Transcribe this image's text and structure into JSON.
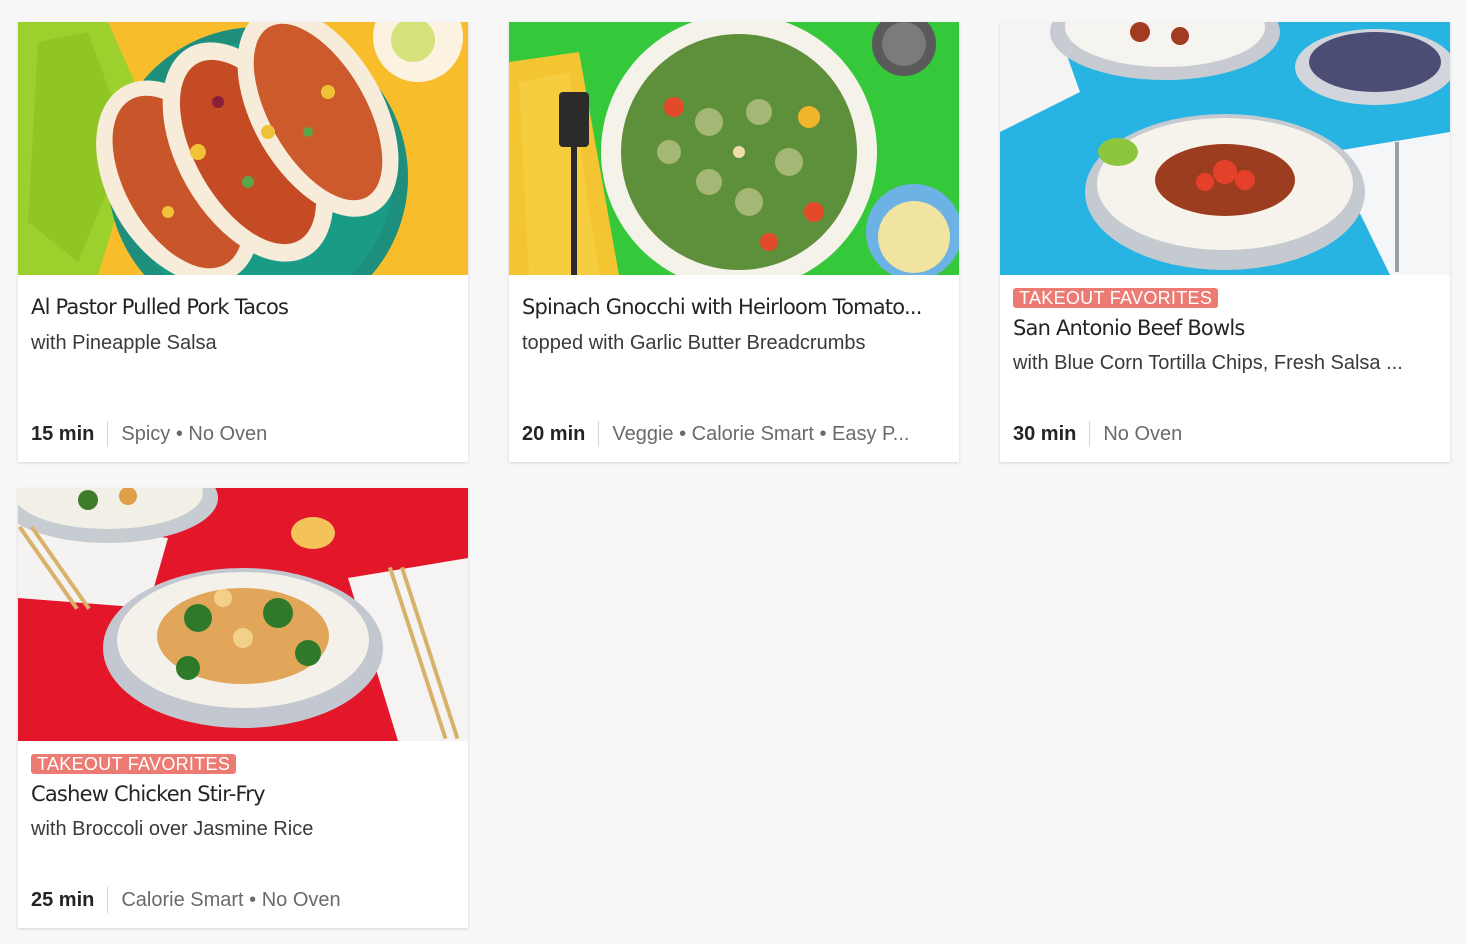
{
  "recipes": [
    {
      "badge": "",
      "title": "Al Pastor Pulled Pork Tacos",
      "subtitle": "with Pineapple Salsa",
      "time": "15 min",
      "tags": "Spicy • No Oven"
    },
    {
      "badge": "",
      "title": "Spinach Gnocchi with Heirloom Tomato...",
      "subtitle": "topped with Garlic Butter Breadcrumbs",
      "time": "20 min",
      "tags": "Veggie • Calorie Smart • Easy P..."
    },
    {
      "badge": "TAKEOUT FAVORITES",
      "title": "San Antonio Beef Bowls",
      "subtitle": "with Blue Corn Tortilla Chips, Fresh Salsa ...",
      "time": "30 min",
      "tags": "No Oven"
    },
    {
      "badge": "TAKEOUT FAVORITES",
      "title": "Cashew Chicken Stir-Fry",
      "subtitle": "with Broccoli over Jasmine Rice",
      "time": "25 min",
      "tags": "Calorie Smart • No Oven"
    }
  ],
  "colors": {
    "badge": "#ec7c73",
    "photo_backgrounds": [
      "#f7b926",
      "#34c83a",
      "#27b4e2",
      "#e3162a"
    ]
  }
}
